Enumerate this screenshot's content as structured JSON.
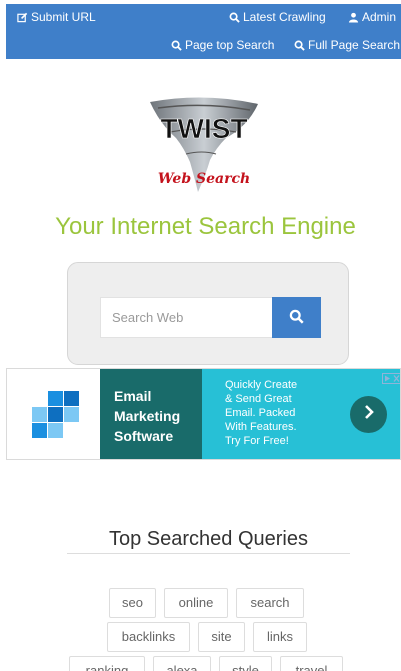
{
  "nav": {
    "submit_url": "Submit URL",
    "latest_crawling": "Latest Crawling",
    "admin": "Admin",
    "page_top_search": "Page top Search",
    "full_page_search": "Full Page Search"
  },
  "logo": {
    "name": "TWIST",
    "subtitle": "Web Search"
  },
  "tagline": "Your Internet Search Engine",
  "search": {
    "placeholder": "Search Web",
    "value": ""
  },
  "ad": {
    "title_lines": [
      "Email",
      "Marketing",
      "Software"
    ],
    "text_lines": [
      "Quickly Create",
      "& Send Great",
      "Email. Packed",
      "With Features.",
      "Try For Free!"
    ]
  },
  "top_queries": {
    "title": "Top Searched Queries",
    "tags": [
      "seo",
      "online",
      "search",
      "backlinks",
      "site",
      "links",
      "ranking",
      "alexa",
      "style",
      "travel"
    ]
  },
  "colors": {
    "navbar": "#3f7fc9",
    "tagline": "#9bc53d",
    "ad_dark": "#196b6a",
    "ad_light": "#27c0d6"
  }
}
